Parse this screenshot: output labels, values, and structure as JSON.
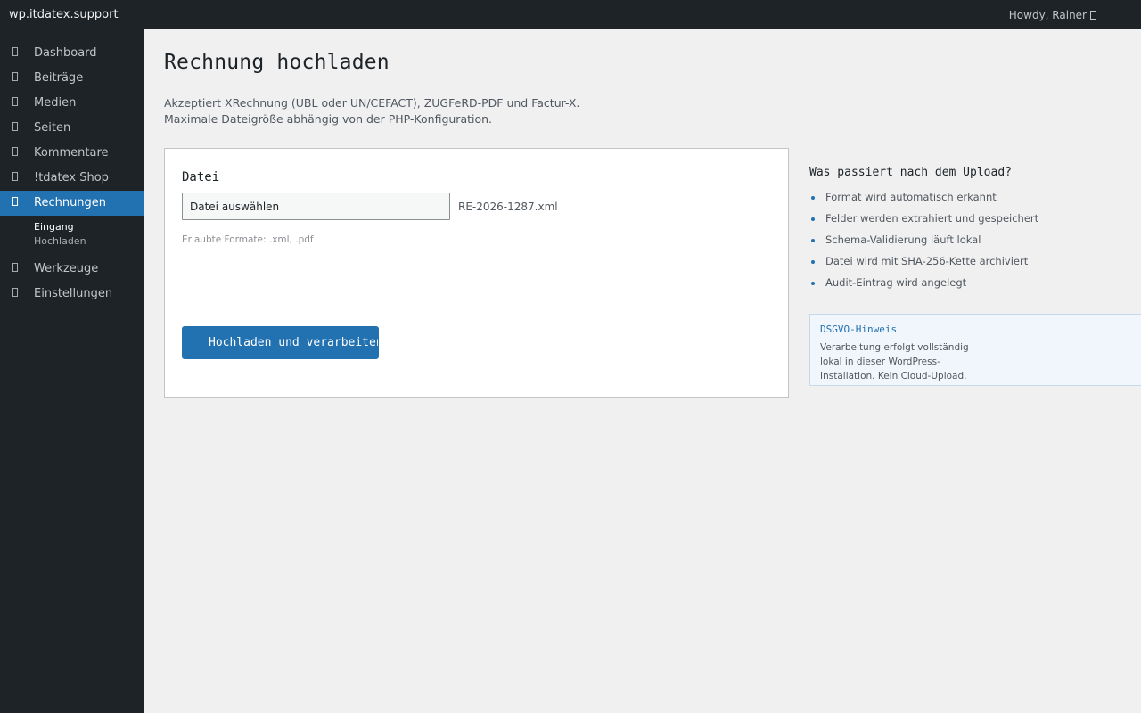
{
  "adminbar": {
    "site_name": "wp.itdatex.support",
    "howdy": "Howdy, Rainer"
  },
  "sidebar": {
    "items": [
      {
        "label": "Dashboard",
        "icon": "dashboard-icon"
      },
      {
        "label": "Beiträge",
        "icon": "pin-icon"
      },
      {
        "label": "Medien",
        "icon": "media-icon"
      },
      {
        "label": "Seiten",
        "icon": "page-icon"
      },
      {
        "label": "Kommentare",
        "icon": "comment-icon"
      },
      {
        "label": "!tdatex Shop",
        "icon": "shop-icon"
      },
      {
        "label": "Rechnungen",
        "icon": "invoice-icon",
        "active": true
      },
      {
        "label": "Werkzeuge",
        "icon": "tools-icon"
      },
      {
        "label": "Einstellungen",
        "icon": "settings-icon"
      }
    ],
    "submenu": [
      {
        "label": "Eingang",
        "current": true
      },
      {
        "label": "Hochladen"
      }
    ]
  },
  "main": {
    "title": "Rechnung hochladen",
    "intro_line1": "Akzeptiert XRechnung (UBL oder UN/CEFACT), ZUGFeRD-PDF und Factur-X.",
    "intro_line2": "Maximale Dateigröße abhängig von der PHP-Konfiguration.",
    "form": {
      "field_label": "Datei",
      "file_button": "Datei auswählen",
      "file_name": "RE-2026-1287.xml",
      "hint": "Erlaubte Formate: .xml, .pdf",
      "submit_label": "Hochladen und verarbeiten"
    }
  },
  "aside": {
    "title": "Was passiert nach dem Upload?",
    "steps": [
      "Format wird automatisch erkannt",
      "Felder werden extrahiert und gespeichert",
      "Schema-Validierung läuft lokal",
      "Datei wird mit SHA-256-Kette archiviert",
      "Audit-Eintrag wird angelegt"
    ],
    "notice": {
      "title": "DSGVO-Hinweis",
      "text": "Verarbeitung erfolgt vollständig lokal in dieser WordPress-Installation. Kein Cloud-Upload."
    }
  },
  "colors": {
    "accent": "#2271b1",
    "sidebar_bg": "#1d2327",
    "page_bg": "#f0f0f1"
  }
}
